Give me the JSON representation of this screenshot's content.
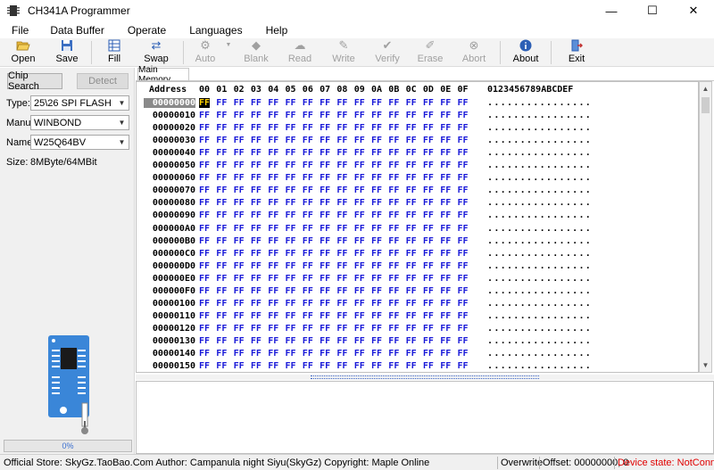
{
  "window": {
    "title": "CH341A Programmer",
    "controls": {
      "minimize": "—",
      "maximize": "☐",
      "close": "✕"
    }
  },
  "menu": [
    "File",
    "Data Buffer",
    "Operate",
    "Languages",
    "Help"
  ],
  "toolbar": {
    "open": "Open",
    "save": "Save",
    "fill": "Fill",
    "swap": "Swap",
    "auto": "Auto",
    "blank": "Blank",
    "read": "Read",
    "write": "Write",
    "verify": "Verify",
    "erase": "Erase",
    "abort": "Abort",
    "about": "About",
    "exit": "Exit"
  },
  "left": {
    "chip_search": "Chip Search",
    "detect": "Detect",
    "type_label": "Type:",
    "type_value": "25\\26 SPI FLASH",
    "manu_label": "Manu:",
    "manu_value": "WINBOND",
    "name_label": "Name:",
    "name_value": "W25Q64BV",
    "size_label": "Size:",
    "size_value": "8MByte/64MBit",
    "progress": "0%",
    "progress_fraction": 0
  },
  "tab": {
    "label": "Main Memory"
  },
  "hex": {
    "address_header": "Address",
    "columns": [
      "00",
      "01",
      "02",
      "03",
      "04",
      "05",
      "06",
      "07",
      "08",
      "09",
      "0A",
      "0B",
      "0C",
      "0D",
      "0E",
      "0F"
    ],
    "ascii_header": "0123456789ABCDEF",
    "byte_value": "FF",
    "ascii_row": "................",
    "rows": [
      "00000000",
      "00000010",
      "00000020",
      "00000030",
      "00000040",
      "00000050",
      "00000060",
      "00000070",
      "00000080",
      "00000090",
      "000000A0",
      "000000B0",
      "000000C0",
      "000000D0",
      "000000E0",
      "000000F0",
      "00000100",
      "00000110",
      "00000120",
      "00000130",
      "00000140",
      "00000150"
    ]
  },
  "status": {
    "store": "Official Store: SkyGz.TaoBao.Com Author: Campanula night Siyu(SkyGz) Copyright: Maple Online",
    "mode": "Overwrite",
    "offset": "Offset: 00000000, 0",
    "device": "Device state: NotConnect;"
  },
  "colors": {
    "hex_byte": "#1818d8",
    "device_state": "#e00000",
    "progress_text": "#3a6fd0",
    "chip_board": "#3a86d8"
  }
}
